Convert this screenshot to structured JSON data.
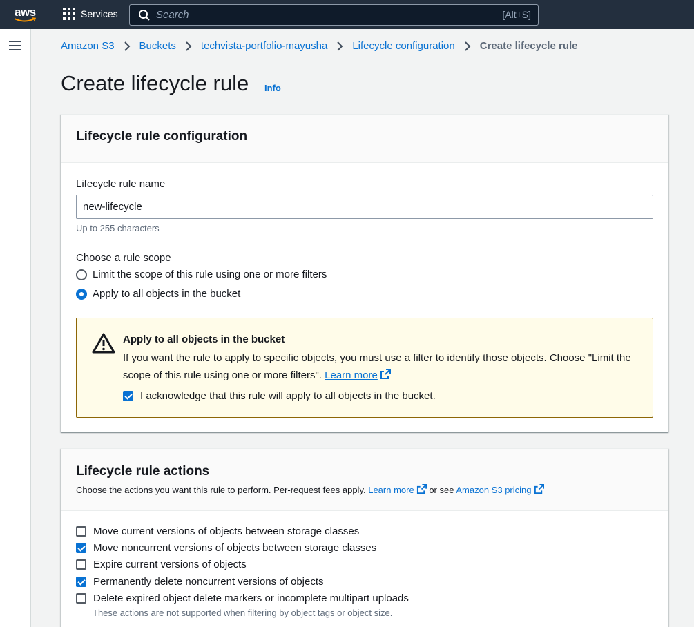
{
  "topnav": {
    "logo_text": "aws",
    "services_label": "Services",
    "search_placeholder": "Search",
    "search_shortcut": "[Alt+S]"
  },
  "breadcrumbs": {
    "items": [
      "Amazon S3",
      "Buckets",
      "techvista-portfolio-mayusha",
      "Lifecycle configuration"
    ],
    "current": "Create lifecycle rule"
  },
  "page": {
    "title": "Create lifecycle rule",
    "info_label": "Info"
  },
  "config_panel": {
    "title": "Lifecycle rule configuration",
    "name_label": "Lifecycle rule name",
    "name_value": "new-lifecycle",
    "name_hint": "Up to 255 characters",
    "scope_label": "Choose a rule scope",
    "scope_options": [
      {
        "label": "Limit the scope of this rule using one or more filters",
        "selected": false
      },
      {
        "label": "Apply to all objects in the bucket",
        "selected": true
      }
    ],
    "alert": {
      "title": "Apply to all objects in the bucket",
      "body": "If you want the rule to apply to specific objects, you must use a filter to identify those objects. Choose \"Limit the scope of this rule using one or more filters\".",
      "link": "Learn more",
      "ack_label": "I acknowledge that this rule will apply to all objects in the bucket.",
      "ack_checked": true
    }
  },
  "actions_panel": {
    "title": "Lifecycle rule actions",
    "desc_prefix": "Choose the actions you want this rule to perform. Per-request fees apply.",
    "learn_more": "Learn more",
    "or_see": "or see",
    "pricing_link": "Amazon S3 pricing",
    "actions": [
      {
        "label": "Move current versions of objects between storage classes",
        "checked": false
      },
      {
        "label": "Move noncurrent versions of objects between storage classes",
        "checked": true
      },
      {
        "label": "Expire current versions of objects",
        "checked": false
      },
      {
        "label": "Permanently delete noncurrent versions of objects",
        "checked": true
      },
      {
        "label": "Delete expired object delete markers or incomplete multipart uploads",
        "checked": false
      }
    ],
    "note": "These actions are not supported when filtering by object tags or object size."
  },
  "colors": {
    "nav_bg": "#232f3e",
    "link": "#0972d3",
    "alert_bg": "#fffce9",
    "alert_border": "#8d6605"
  }
}
